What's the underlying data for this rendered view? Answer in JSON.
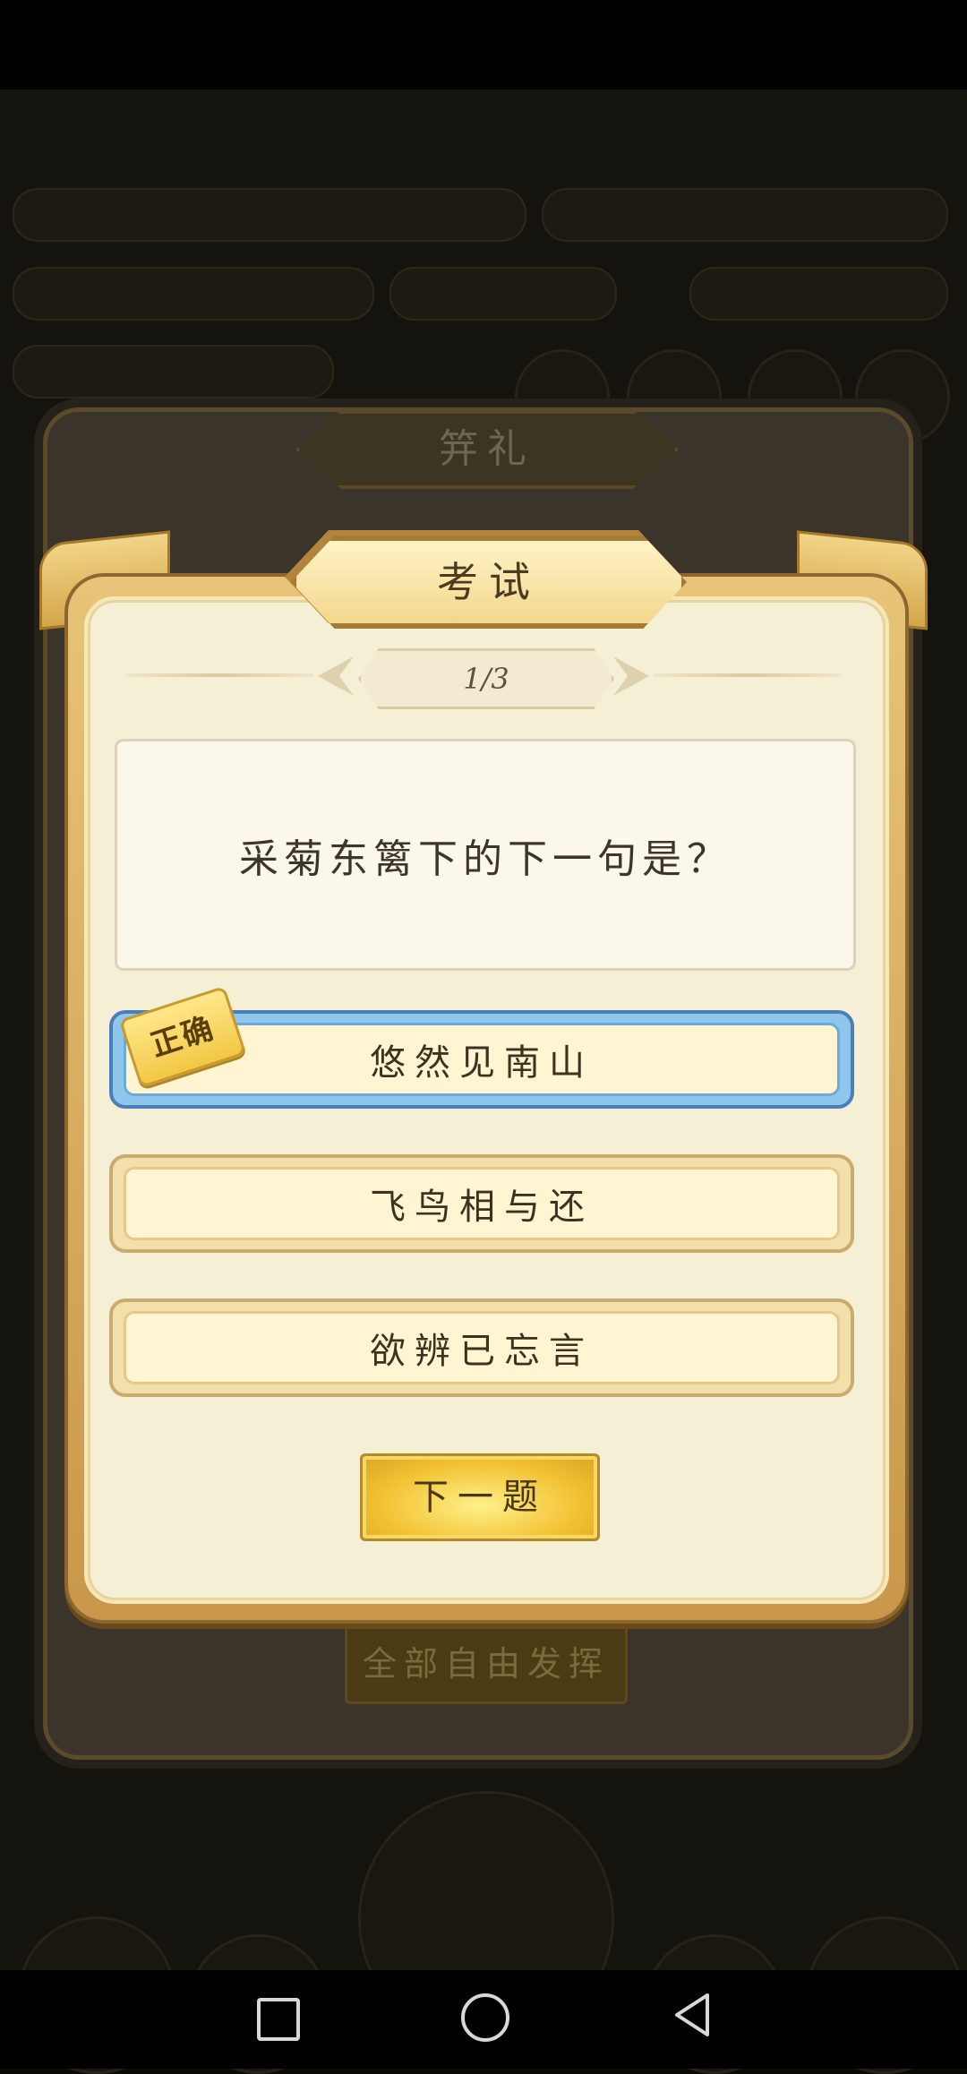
{
  "background": {
    "panel_title": "笄礼",
    "free_button_label": "全部自由发挥"
  },
  "exam": {
    "title": "考试",
    "progress": "1/3",
    "question": "采菊东篱下的下一句是？",
    "correct_tag": "正确",
    "options": [
      {
        "label": "悠然见南山",
        "selected": true
      },
      {
        "label": "飞鸟相与还",
        "selected": false
      },
      {
        "label": "欲辨已忘言",
        "selected": false
      }
    ],
    "next_label": "下一题"
  },
  "colors": {
    "selected_option": "#8ec6ee",
    "button_gold": "#f2c233",
    "panel_cream": "#f5efd6"
  },
  "nav": {
    "recent_icon": "square-icon",
    "home_icon": "circle-icon",
    "back_icon": "triangle-back-icon"
  }
}
